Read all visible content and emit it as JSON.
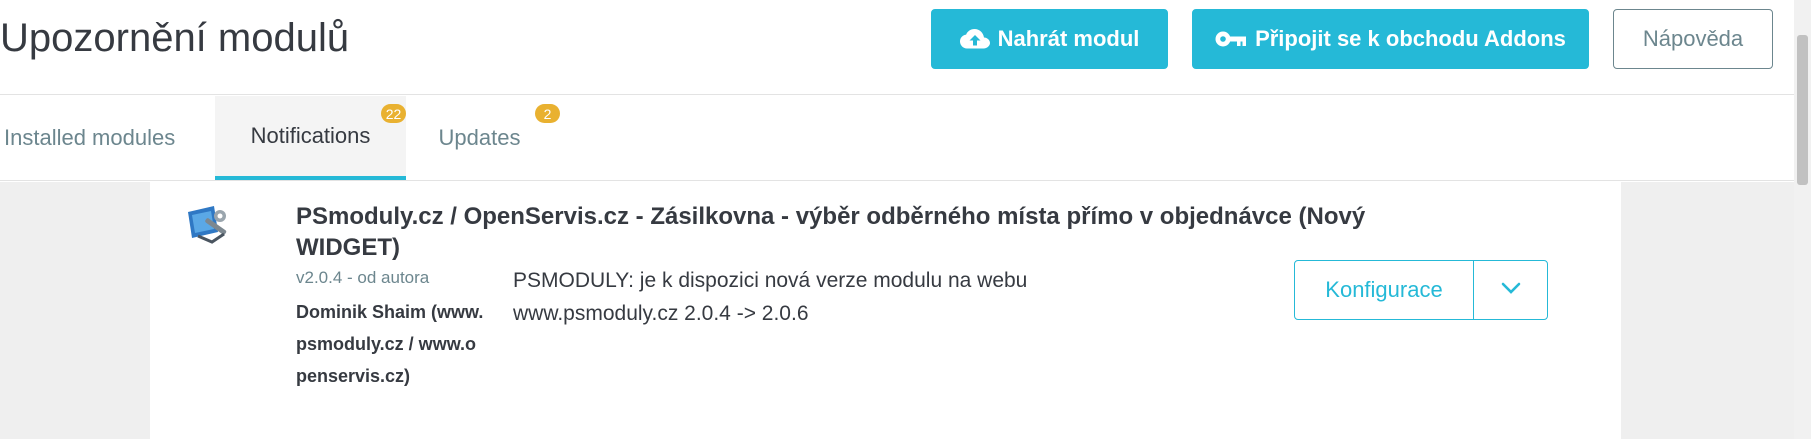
{
  "header": {
    "title": "Upozornění modulů",
    "upload_button": "Nahrát modul",
    "connect_button": "Připojit se k obchodu Addons",
    "help_button": "Nápověda"
  },
  "tabs": [
    {
      "label": "Installed modules"
    },
    {
      "label": "Notifications",
      "badge": "22",
      "active": true
    },
    {
      "label": "Updates",
      "badge": "2"
    }
  ],
  "module": {
    "name": "PSmoduly.cz / OpenServis.cz - Zásilkovna - výběr odběrného místa přímo v objednávce (Nový WIDGET)",
    "version_prefix": "v2.0.4 - od autora",
    "author": "Dominik Shaim (www.psmoduly.cz / www.openservis.cz)",
    "description": "PSMODULY: je k dispozici nová verze modulu na webu www.psmoduly.cz 2.0.4 -> 2.0.6",
    "configure_button": "Konfigurace"
  },
  "colors": {
    "accent": "#25b9d7",
    "badge": "#e9b130",
    "text": "#363a41",
    "muted": "#6c868e"
  }
}
